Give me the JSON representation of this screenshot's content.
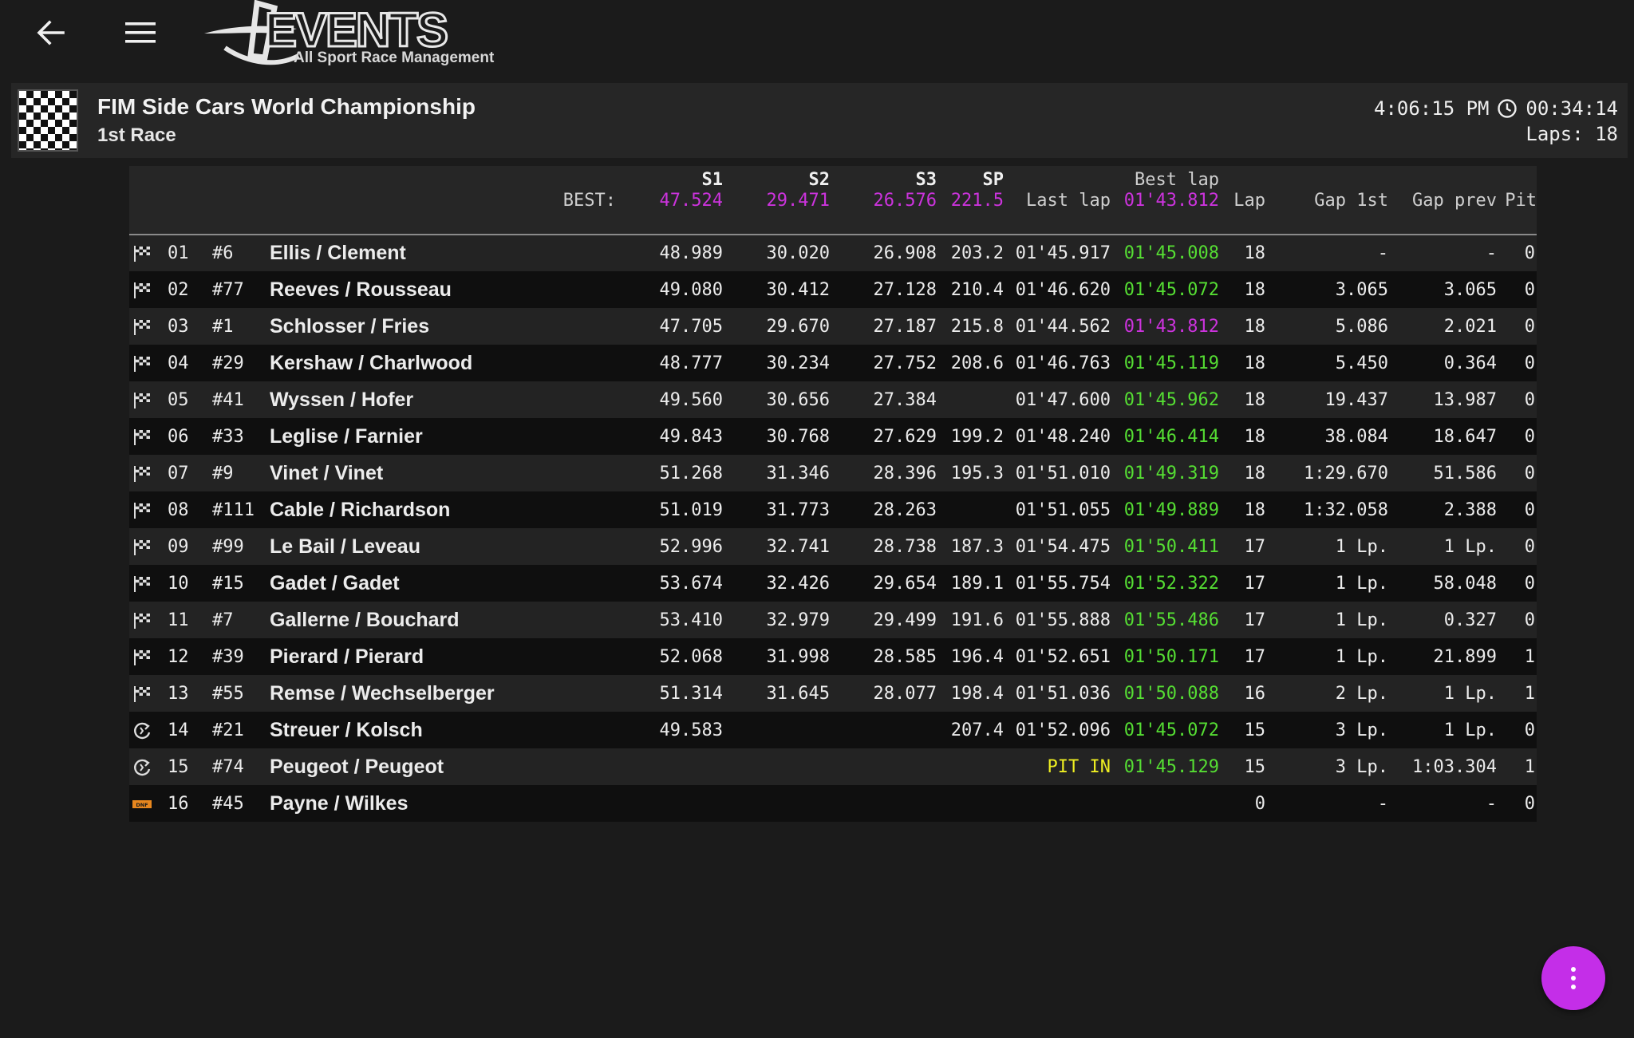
{
  "app": {
    "logo_text": "EVENTS",
    "logo_tagline": "All Sport Race Management"
  },
  "header": {
    "event_name": "FIM Side Cars World Championship",
    "race_name": "1st Race",
    "clock_time": "4:06:15 PM",
    "elapsed": "00:34:14",
    "laps": "Laps: 18"
  },
  "table": {
    "columns": {
      "s1": "S1",
      "s2": "S2",
      "s3": "S3",
      "sp": "SP",
      "best_lap": "Best lap",
      "last_lap": "Last lap",
      "lap": "Lap",
      "gap_1st": "Gap 1st",
      "gap_prev": "Gap prev",
      "pit": "Pit"
    },
    "best": {
      "label": "BEST:",
      "s1": "47.524",
      "s2": "29.471",
      "s3": "26.576",
      "sp": "221.5",
      "best_lap": "01'43.812"
    },
    "rows": [
      {
        "status": "finished",
        "pos": "01",
        "num": "#6",
        "name": "Ellis / Clement",
        "s1": "48.989",
        "s2": "30.020",
        "s3": "26.908",
        "sp": "203.2",
        "last": "01'45.917",
        "best": "01'45.008",
        "lap": "18",
        "gap1": "-",
        "gapprev": "-",
        "pit": "0"
      },
      {
        "status": "finished",
        "pos": "02",
        "num": "#77",
        "name": "Reeves / Rousseau",
        "s1": "49.080",
        "s2": "30.412",
        "s3": "27.128",
        "sp": "210.4",
        "last": "01'46.620",
        "best": "01'45.072",
        "lap": "18",
        "gap1": "3.065",
        "gapprev": "3.065",
        "pit": "0"
      },
      {
        "status": "finished",
        "pos": "03",
        "num": "#1",
        "name": "Schlosser / Fries",
        "s1": "47.705",
        "s2": "29.670",
        "s3": "27.187",
        "sp": "215.8",
        "last": "01'44.562",
        "best": "01'43.812",
        "lap": "18",
        "gap1": "5.086",
        "gapprev": "2.021",
        "pit": "0",
        "overall_best": true
      },
      {
        "status": "finished",
        "pos": "04",
        "num": "#29",
        "name": "Kershaw / Charlwood",
        "s1": "48.777",
        "s2": "30.234",
        "s3": "27.752",
        "sp": "208.6",
        "last": "01'46.763",
        "best": "01'45.119",
        "lap": "18",
        "gap1": "5.450",
        "gapprev": "0.364",
        "pit": "0"
      },
      {
        "status": "finished",
        "pos": "05",
        "num": "#41",
        "name": "Wyssen / Hofer",
        "s1": "49.560",
        "s2": "30.656",
        "s3": "27.384",
        "sp": "",
        "last": "01'47.600",
        "best": "01'45.962",
        "lap": "18",
        "gap1": "19.437",
        "gapprev": "13.987",
        "pit": "0"
      },
      {
        "status": "finished",
        "pos": "06",
        "num": "#33",
        "name": "Leglise / Farnier",
        "s1": "49.843",
        "s2": "30.768",
        "s3": "27.629",
        "sp": "199.2",
        "last": "01'48.240",
        "best": "01'46.414",
        "lap": "18",
        "gap1": "38.084",
        "gapprev": "18.647",
        "pit": "0"
      },
      {
        "status": "finished",
        "pos": "07",
        "num": "#9",
        "name": "Vinet / Vinet",
        "s1": "51.268",
        "s2": "31.346",
        "s3": "28.396",
        "sp": "195.3",
        "last": "01'51.010",
        "best": "01'49.319",
        "lap": "18",
        "gap1": "1:29.670",
        "gapprev": "51.586",
        "pit": "0"
      },
      {
        "status": "finished",
        "pos": "08",
        "num": "#111",
        "name": "Cable / Richardson",
        "s1": "51.019",
        "s2": "31.773",
        "s3": "28.263",
        "sp": "",
        "last": "01'51.055",
        "best": "01'49.889",
        "lap": "18",
        "gap1": "1:32.058",
        "gapprev": "2.388",
        "pit": "0"
      },
      {
        "status": "finished",
        "pos": "09",
        "num": "#99",
        "name": "Le Bail / Leveau",
        "s1": "52.996",
        "s2": "32.741",
        "s3": "28.738",
        "sp": "187.3",
        "last": "01'54.475",
        "best": "01'50.411",
        "lap": "17",
        "gap1": "1 Lp.",
        "gapprev": "1 Lp.",
        "pit": "0"
      },
      {
        "status": "finished",
        "pos": "10",
        "num": "#15",
        "name": "Gadet / Gadet",
        "s1": "53.674",
        "s2": "32.426",
        "s3": "29.654",
        "sp": "189.1",
        "last": "01'55.754",
        "best": "01'52.322",
        "lap": "17",
        "gap1": "1 Lp.",
        "gapprev": "58.048",
        "pit": "0"
      },
      {
        "status": "finished",
        "pos": "11",
        "num": "#7",
        "name": "Gallerne / Bouchard",
        "s1": "53.410",
        "s2": "32.979",
        "s3": "29.499",
        "sp": "191.6",
        "last": "01'55.888",
        "best": "01'55.486",
        "lap": "17",
        "gap1": "1 Lp.",
        "gapprev": "0.327",
        "pit": "0"
      },
      {
        "status": "finished",
        "pos": "12",
        "num": "#39",
        "name": "Pierard / Pierard",
        "s1": "52.068",
        "s2": "31.998",
        "s3": "28.585",
        "sp": "196.4",
        "last": "01'52.651",
        "best": "01'50.171",
        "lap": "17",
        "gap1": "1 Lp.",
        "gapprev": "21.899",
        "pit": "1"
      },
      {
        "status": "finished",
        "pos": "13",
        "num": "#55",
        "name": "Remse / Wechselberger",
        "s1": "51.314",
        "s2": "31.645",
        "s3": "28.077",
        "sp": "198.4",
        "last": "01'51.036",
        "best": "01'50.088",
        "lap": "16",
        "gap1": "2 Lp.",
        "gapprev": "1 Lp.",
        "pit": "1"
      },
      {
        "status": "running",
        "pos": "14",
        "num": "#21",
        "name": "Streuer / Kolsch",
        "s1": "49.583",
        "s2": "",
        "s3": "",
        "sp": "207.4",
        "last": "01'52.096",
        "best": "01'45.072",
        "lap": "15",
        "gap1": "3 Lp.",
        "gapprev": "1 Lp.",
        "pit": "0"
      },
      {
        "status": "running",
        "pos": "15",
        "num": "#74",
        "name": "Peugeot / Peugeot",
        "s1": "",
        "s2": "",
        "s3": "",
        "sp": "",
        "last": "PIT IN",
        "best": "01'45.129",
        "lap": "15",
        "gap1": "3 Lp.",
        "gapprev": "1:03.304",
        "pit": "1",
        "in_pit": true
      },
      {
        "status": "dnf",
        "pos": "16",
        "num": "#45",
        "name": "Payne / Wilkes",
        "s1": "",
        "s2": "",
        "s3": "",
        "sp": "",
        "last": "",
        "best": "",
        "lap": "0",
        "gap1": "-",
        "gapprev": "-",
        "pit": "0"
      }
    ]
  },
  "status_badges": {
    "dnf": "DNF"
  },
  "colors": {
    "background": "#1b1b1b",
    "header_bar": "#262626",
    "row_light": "#232323",
    "row_dark": "#0f0f0f",
    "overall_best": "#cc33dd",
    "personal_best": "#55dd33",
    "pit_in": "#eeee22",
    "dnf_badge": "#e8871e",
    "fab": "#c42ee8"
  },
  "icons": {
    "back": "arrow-left-icon",
    "menu": "hamburger-menu-icon",
    "clock": "clock-icon",
    "finished": "checkered-flag-icon",
    "running": "running-lap-icon",
    "dnf": "dnf-badge-icon",
    "fab": "more-vertical-icon"
  }
}
